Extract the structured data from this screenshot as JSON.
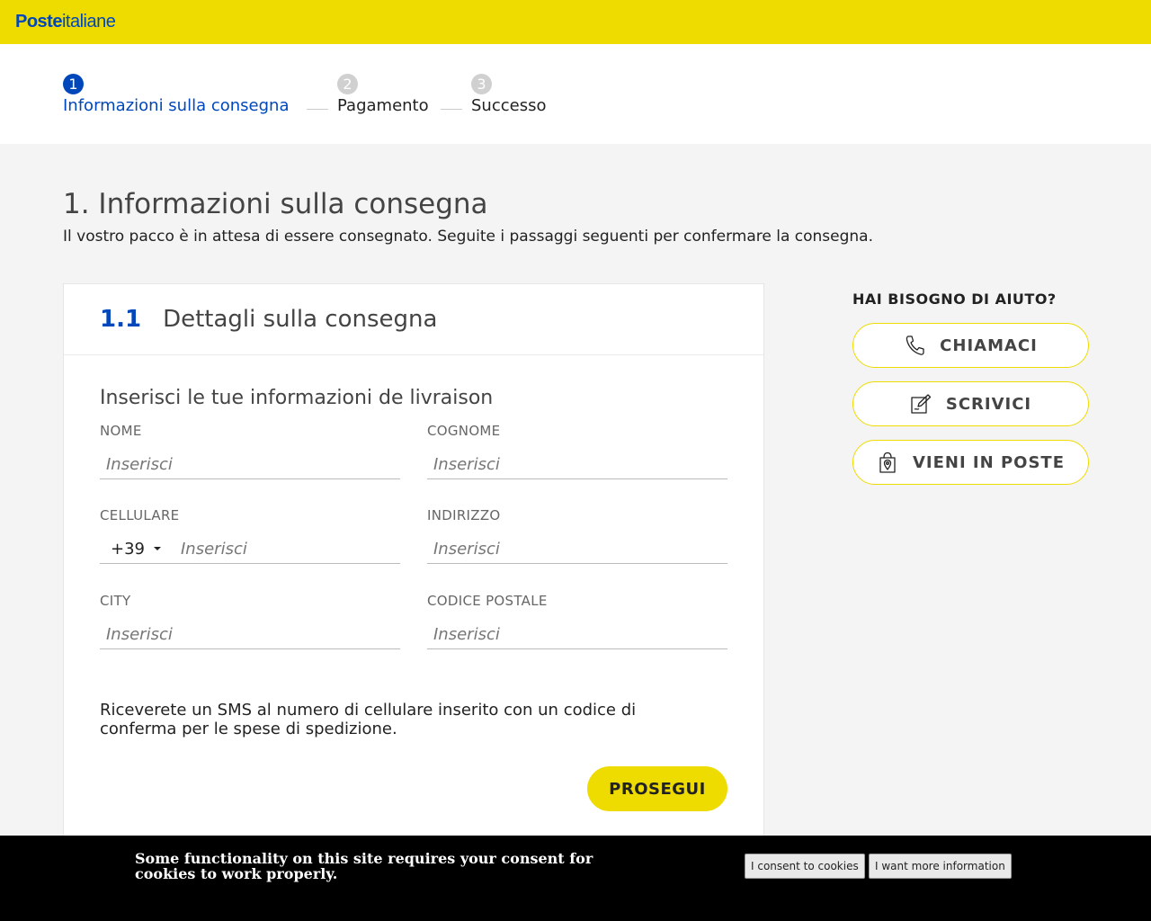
{
  "header": {
    "logo_bold": "Poste",
    "logo_rest": "italiane"
  },
  "stepper": {
    "steps": [
      {
        "number": "1",
        "label": "Informazioni sulla consegna",
        "active": true
      },
      {
        "number": "2",
        "label": "Pagamento",
        "active": false
      },
      {
        "number": "3",
        "label": "Successo",
        "active": false
      }
    ]
  },
  "page": {
    "title": "1. Informazioni sulla consegna",
    "subtitle": "Il vostro pacco è in attesa di essere consegnato. Seguite i passaggi seguenti per confermare la consegna."
  },
  "card": {
    "index": "1.1",
    "title": "Dettagli sulla consegna",
    "form_title": "Inserisci le tue informazioni de livraison",
    "fields": {
      "nome": {
        "label": "NOME",
        "placeholder": "Inserisci",
        "value": ""
      },
      "cognome": {
        "label": "COGNOME",
        "placeholder": "Inserisci",
        "value": ""
      },
      "cellulare": {
        "label": "CELLULARE",
        "prefix": "+39",
        "placeholder": "Inserisci",
        "value": ""
      },
      "indirizzo": {
        "label": "INDIRIZZO",
        "placeholder": "Inserisci",
        "value": ""
      },
      "city": {
        "label": "CITY",
        "placeholder": "Inserisci",
        "value": ""
      },
      "codice_postale": {
        "label": "CODICE POSTALE",
        "placeholder": "Inserisci",
        "value": ""
      }
    },
    "sms_note": "Riceverete un SMS al numero di cellulare inserito con un codice di conferma per le spese di spedizione.",
    "submit_label": "PROSEGUI"
  },
  "help": {
    "title": "HAI BISOGNO DI AIUTO?",
    "buttons": [
      {
        "label": "CHIAMACI",
        "icon": "phone-icon"
      },
      {
        "label": "SCRIVICI",
        "icon": "edit-icon"
      },
      {
        "label": "VIENI IN POSTE",
        "icon": "location-bag-icon"
      }
    ]
  },
  "cookie": {
    "message": "Some functionality on this site requires your consent for cookies to work properly.",
    "consent_label": "I consent to cookies",
    "info_label": "I want more information"
  },
  "colors": {
    "brand_yellow": "#eedc00",
    "brand_blue": "#0047bb"
  }
}
